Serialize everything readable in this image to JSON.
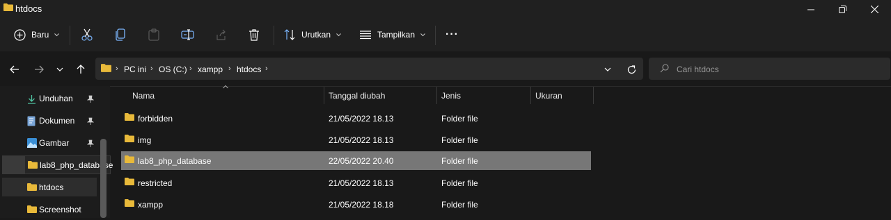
{
  "window": {
    "title": "htdocs"
  },
  "commandbar": {
    "new_label": "Baru",
    "sort_label": "Urutkan",
    "view_label": "Tampilkan",
    "more_label": "···"
  },
  "address": {
    "crumbs": [
      "PC ini",
      "OS (C:)",
      "xampp",
      "htdocs"
    ]
  },
  "search": {
    "placeholder": "Cari htdocs"
  },
  "sidebar": {
    "items": [
      {
        "label": "Unduhan",
        "icon": "download-icon",
        "pinned": true
      },
      {
        "label": "Dokumen",
        "icon": "document-icon",
        "pinned": true
      },
      {
        "label": "Gambar",
        "icon": "picture-icon",
        "pinned": true
      },
      {
        "label": "lab8_php_database",
        "icon": "folder-icon",
        "pinned": false,
        "tooltip": true
      },
      {
        "label": "htdocs",
        "icon": "folder-icon",
        "pinned": false,
        "current": true
      },
      {
        "label": "Screenshot",
        "icon": "folder-icon",
        "pinned": false
      }
    ]
  },
  "list": {
    "columns": [
      "Nama",
      "Tanggal diubah",
      "Jenis",
      "Ukuran"
    ],
    "rows": [
      {
        "name": "forbidden",
        "date": "21/05/2022 18.13",
        "type": "Folder file",
        "size": ""
      },
      {
        "name": "img",
        "date": "21/05/2022 18.13",
        "type": "Folder file",
        "size": ""
      },
      {
        "name": "lab8_php_database",
        "date": "22/05/2022 20.40",
        "type": "Folder file",
        "size": "",
        "selected": true
      },
      {
        "name": "restricted",
        "date": "21/05/2022 18.13",
        "type": "Folder file",
        "size": ""
      },
      {
        "name": "xampp",
        "date": "21/05/2022 18.18",
        "type": "Folder file",
        "size": ""
      }
    ]
  },
  "colors": {
    "folder": "#e8b93a",
    "selected_row": "#777777",
    "background": "#191919"
  }
}
